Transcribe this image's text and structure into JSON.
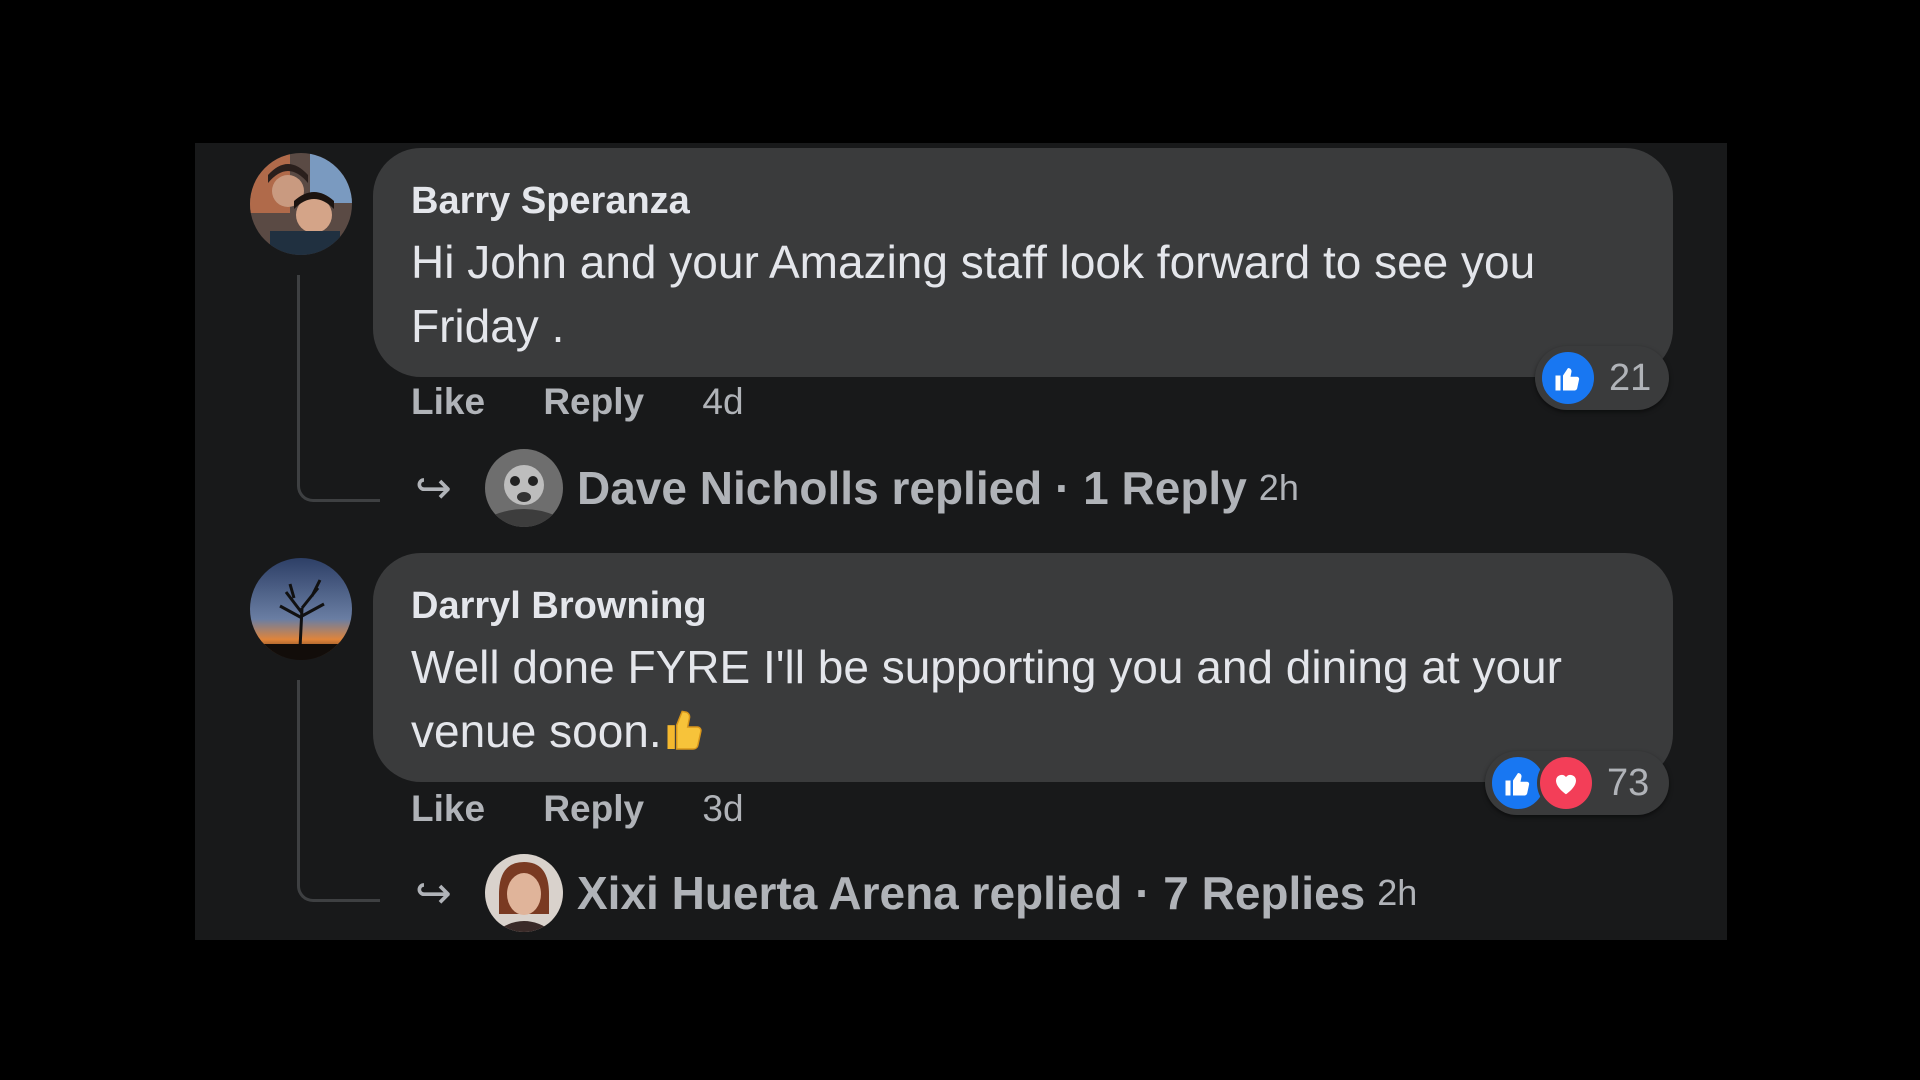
{
  "comments": [
    {
      "author": "Barry Speranza",
      "text": "Hi John and your Amazing staff look forward to see you Friday .",
      "like_label": "Like",
      "reply_label": "Reply",
      "time": "4d",
      "reaction_count": "21",
      "reactions": [
        "like-icon"
      ],
      "reply_summary": {
        "text": "Dave Nicholls replied · 1 Reply",
        "time": "2h"
      }
    },
    {
      "author": "Darryl Browning",
      "text": "Well done FYRE I'll be supporting you and dining at your venue soon.",
      "emoji": "thumbs-up-emoji",
      "like_label": "Like",
      "reply_label": "Reply",
      "time": "3d",
      "reaction_count": "73",
      "reactions": [
        "like-icon",
        "love-icon"
      ],
      "reply_summary": {
        "text": "Xixi Huerta Arena replied · 7 Replies",
        "time": "2h"
      }
    }
  ],
  "colors": {
    "page_background": "#000000",
    "panel_background": "#18191a",
    "bubble": "#3a3b3c",
    "text_primary": "#e4e6eb",
    "text_secondary": "#b0b3b8",
    "like_blue": "#1877f2",
    "love_red": "#f33e58"
  }
}
